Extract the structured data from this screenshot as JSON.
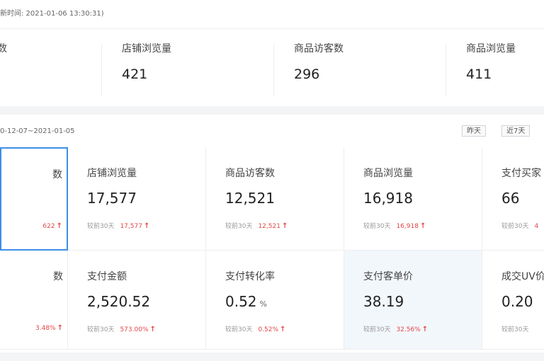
{
  "header": {
    "update_note": "新时间: 2021-01-06 13:30:31)"
  },
  "top_metrics": [
    {
      "label": "数",
      "value": ""
    },
    {
      "label": "店铺浏览量",
      "value": "421"
    },
    {
      "label": "商品访客数",
      "value": "296"
    },
    {
      "label": "商品浏览量",
      "value": "411"
    }
  ],
  "range": {
    "text": "0-12-07~2021-01-05",
    "buttons": [
      "昨天",
      "近7天"
    ]
  },
  "row1": [
    {
      "label": "数",
      "value": "",
      "cmp_label": "",
      "cmp_value": "622"
    },
    {
      "label": "店铺浏览量",
      "value": "17,577",
      "cmp_label": "较前30天",
      "cmp_value": "17,577"
    },
    {
      "label": "商品访客数",
      "value": "12,521",
      "cmp_label": "较前30天",
      "cmp_value": "12,521"
    },
    {
      "label": "商品浏览量",
      "value": "16,918",
      "cmp_label": "较前30天",
      "cmp_value": "16,918"
    },
    {
      "label": "支付买家",
      "value": "66",
      "cmp_label": "较前30天",
      "cmp_value": "4"
    }
  ],
  "row2": [
    {
      "label": "数",
      "value": "",
      "unit": "",
      "cmp_label": "",
      "cmp_value": "3.48%"
    },
    {
      "label": "支付金额",
      "value": "2,520.52",
      "unit": "",
      "cmp_label": "较前30天",
      "cmp_value": "573.00%"
    },
    {
      "label": "支付转化率",
      "value": "0.52",
      "unit": "%",
      "cmp_label": "较前30天",
      "cmp_value": "0.52%"
    },
    {
      "label": "支付客单价",
      "value": "38.19",
      "unit": "",
      "cmp_label": "较前30天",
      "cmp_value": "32.56%"
    },
    {
      "label": "成交UV价",
      "value": "0.20",
      "unit": "",
      "cmp_label": "较前30天",
      "cmp_value": ""
    }
  ],
  "icons": {
    "trend": "arrow-up-icon",
    "trend_color": "#e54646"
  },
  "colors": {
    "accent": "#3d8ee8",
    "up": "#e54646"
  }
}
